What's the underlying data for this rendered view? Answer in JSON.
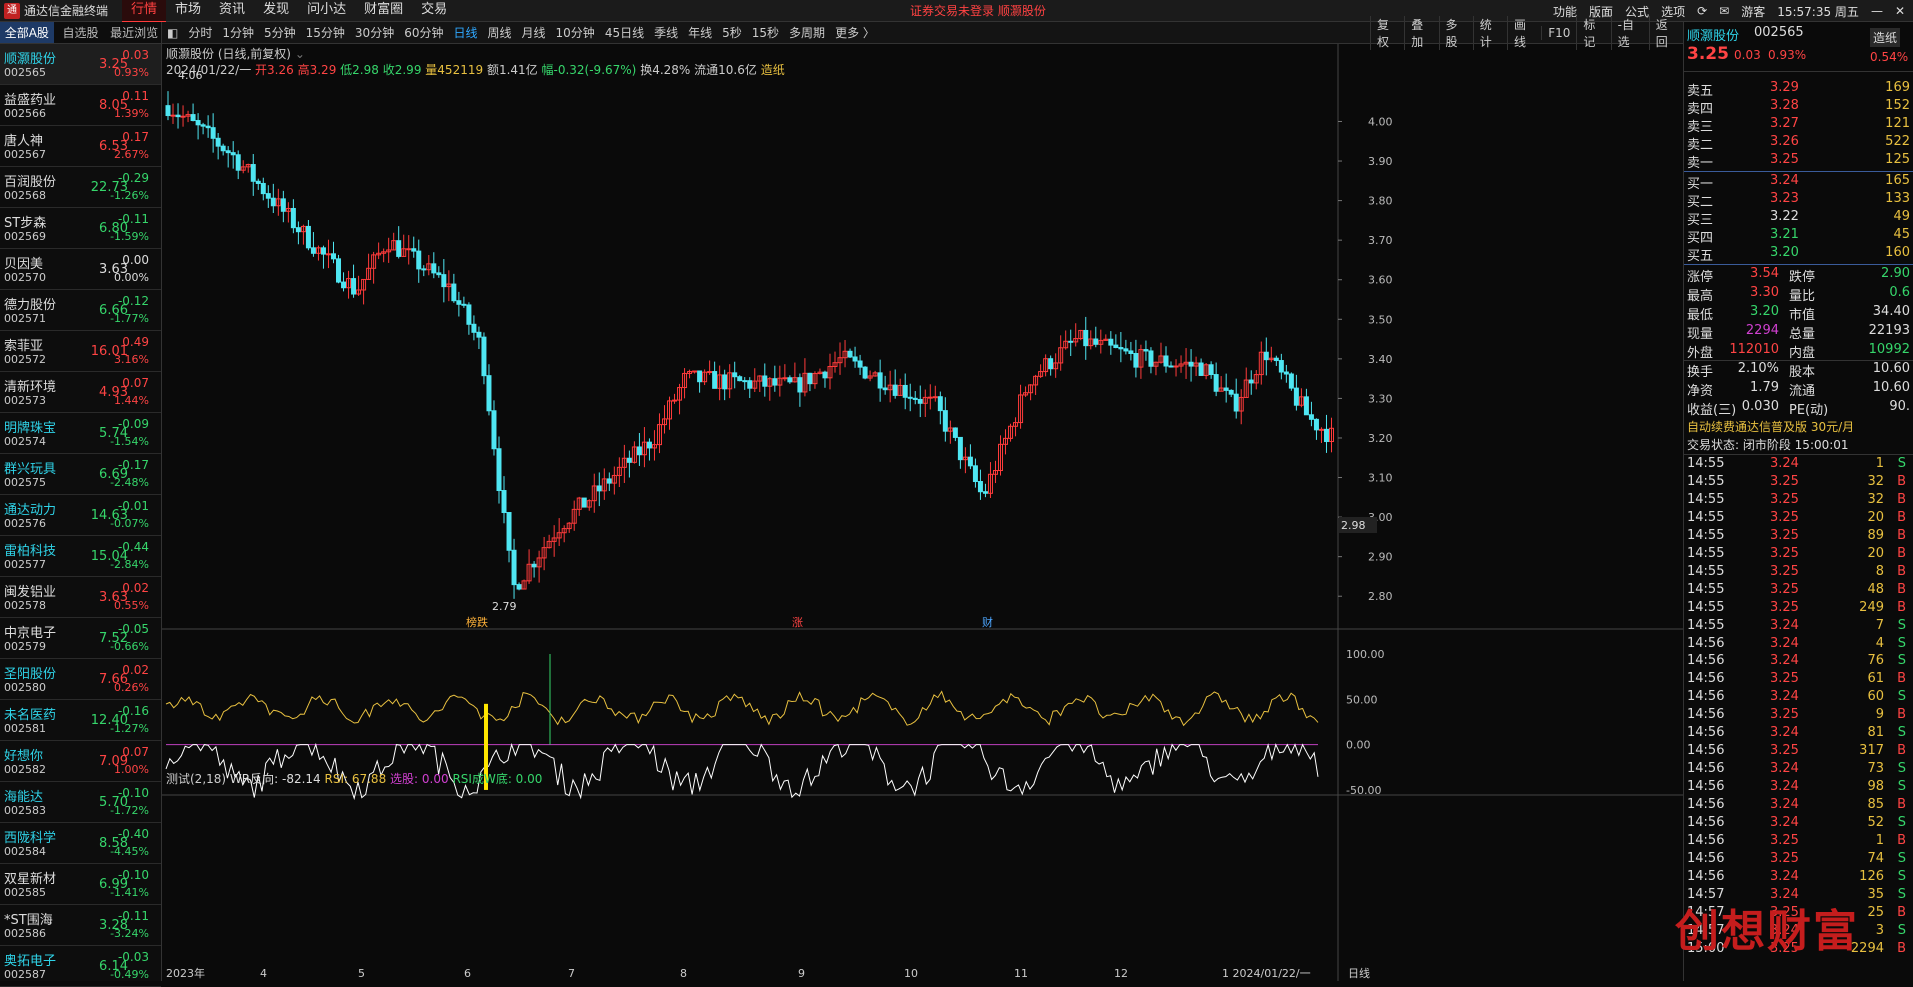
{
  "app": {
    "title": "通达信金融终端",
    "menu": [
      "行情",
      "市场",
      "资讯",
      "发现",
      "问小达",
      "财富圈",
      "交易"
    ],
    "notice": "证券交易未登录  顺灏股份",
    "right_menu": [
      "功能",
      "版面",
      "公式",
      "选项"
    ],
    "user": "游客",
    "clock": "15:57:35 周五"
  },
  "left": {
    "tabs": [
      "全部A股",
      "自选股",
      "最近浏览"
    ],
    "stocks": [
      {
        "name": "顺灏股份",
        "code": "002565",
        "price": "3.25",
        "chg": "0.03",
        "pct": "0.93%",
        "dir": "up",
        "cyan": true
      },
      {
        "name": "益盛药业",
        "code": "002566",
        "price": "8.05",
        "chg": "0.11",
        "pct": "1.39%",
        "dir": "up",
        "cyan": false
      },
      {
        "name": "唐人神",
        "code": "002567",
        "price": "6.53",
        "chg": "0.17",
        "pct": "2.67%",
        "dir": "up",
        "cyan": false
      },
      {
        "name": "百润股份",
        "code": "002568",
        "price": "22.73",
        "chg": "-0.29",
        "pct": "-1.26%",
        "dir": "dn",
        "cyan": false
      },
      {
        "name": "ST步森",
        "code": "002569",
        "price": "6.80",
        "chg": "-0.11",
        "pct": "-1.59%",
        "dir": "dn",
        "cyan": false
      },
      {
        "name": "贝因美",
        "code": "002570",
        "price": "3.63",
        "chg": "0.00",
        "pct": "0.00%",
        "dir": "fl",
        "cyan": false
      },
      {
        "name": "德力股份",
        "code": "002571",
        "price": "6.66",
        "chg": "-0.12",
        "pct": "-1.77%",
        "dir": "dn",
        "cyan": false
      },
      {
        "name": "索菲亚",
        "code": "002572",
        "price": "16.01",
        "chg": "0.49",
        "pct": "3.16%",
        "dir": "up",
        "cyan": false
      },
      {
        "name": "清新环境",
        "code": "002573",
        "price": "4.93",
        "chg": "0.07",
        "pct": "1.44%",
        "dir": "up",
        "cyan": false
      },
      {
        "name": "明牌珠宝",
        "code": "002574",
        "price": "5.74",
        "chg": "-0.09",
        "pct": "-1.54%",
        "dir": "dn",
        "cyan": true
      },
      {
        "name": "群兴玩具",
        "code": "002575",
        "price": "6.69",
        "chg": "-0.17",
        "pct": "-2.48%",
        "dir": "dn",
        "cyan": true
      },
      {
        "name": "通达动力",
        "code": "002576",
        "price": "14.63",
        "chg": "-0.01",
        "pct": "-0.07%",
        "dir": "dn",
        "cyan": true
      },
      {
        "name": "雷柏科技",
        "code": "002577",
        "price": "15.04",
        "chg": "-0.44",
        "pct": "-2.84%",
        "dir": "dn",
        "cyan": true
      },
      {
        "name": "闽发铝业",
        "code": "002578",
        "price": "3.63",
        "chg": "0.02",
        "pct": "0.55%",
        "dir": "up",
        "cyan": false
      },
      {
        "name": "中京电子",
        "code": "002579",
        "price": "7.52",
        "chg": "-0.05",
        "pct": "-0.66%",
        "dir": "dn",
        "cyan": false
      },
      {
        "name": "圣阳股份",
        "code": "002580",
        "price": "7.66",
        "chg": "0.02",
        "pct": "0.26%",
        "dir": "up",
        "cyan": true
      },
      {
        "name": "未名医药",
        "code": "002581",
        "price": "12.40",
        "chg": "-0.16",
        "pct": "-1.27%",
        "dir": "dn",
        "cyan": true
      },
      {
        "name": "好想你",
        "code": "002582",
        "price": "7.09",
        "chg": "0.07",
        "pct": "1.00%",
        "dir": "up",
        "cyan": true
      },
      {
        "name": "海能达",
        "code": "002583",
        "price": "5.70",
        "chg": "-0.10",
        "pct": "-1.72%",
        "dir": "dn",
        "cyan": true
      },
      {
        "name": "西陇科学",
        "code": "002584",
        "price": "8.58",
        "chg": "-0.40",
        "pct": "-4.45%",
        "dir": "dn",
        "cyan": true
      },
      {
        "name": "双星新材",
        "code": "002585",
        "price": "6.99",
        "chg": "-0.10",
        "pct": "-1.41%",
        "dir": "dn",
        "cyan": false
      },
      {
        "name": "*ST围海",
        "code": "002586",
        "price": "3.28",
        "chg": "-0.11",
        "pct": "-3.24%",
        "dir": "dn",
        "cyan": false
      },
      {
        "name": "奥拓电子",
        "code": "002587",
        "price": "6.14",
        "chg": "-0.03",
        "pct": "-0.49%",
        "dir": "dn",
        "cyan": true
      }
    ]
  },
  "timeframes": [
    "分时",
    "1分钟",
    "5分钟",
    "15分钟",
    "30分钟",
    "60分钟",
    "日线",
    "周线",
    "月线",
    "10分钟",
    "45日线",
    "季线",
    "年线",
    "5秒",
    "15秒",
    "多周期",
    "更多 〉"
  ],
  "active_tf": "日线",
  "tf_right": [
    "复权",
    "叠加",
    "多股",
    "统计",
    "画线",
    "F10",
    "标记",
    "-自选",
    "返回"
  ],
  "stock_info": "顺灏股份 (日线,前复权)",
  "quote": {
    "date": "2024/01/22/一",
    "open": "开3.26",
    "high": "高3.29",
    "low": "低2.98",
    "close": "收2.99",
    "vol": "量452119",
    "amt": "额1.41亿",
    "rng": "幅-0.32(-9.67%)",
    "turn": "换4.28%",
    "float": "流通10.6亿",
    "tag": "造纸"
  },
  "indicator": {
    "name": "测试(2,18)",
    "wr": "WR反向: -82.14",
    "rsi": "RSI: 67.88",
    "sel": "选股: 0.00",
    "rsiw": "RSI成W底: 0.00"
  },
  "chart_labels": {
    "max": "4.06",
    "min": "2.79",
    "cur": "2.98",
    "markers": [
      "榜跌",
      "涨",
      "财"
    ]
  },
  "chart_data": {
    "type": "candlestick",
    "ylim": [
      2.75,
      4.12
    ],
    "yticks": [
      "4.00",
      "3.90",
      "3.80",
      "3.70",
      "3.60",
      "3.50",
      "3.40",
      "3.30",
      "3.20",
      "3.10",
      "3.00",
      "2.90",
      "2.80"
    ],
    "xticks": [
      "2023年",
      "4",
      "5",
      "6",
      "7",
      "8",
      "9",
      "10",
      "11",
      "12",
      "1 2024/01/22/一"
    ],
    "ind_yticks": [
      "100.00",
      "50.00",
      "0.00",
      "-50.00"
    ],
    "xbar": "日线"
  },
  "right": {
    "name": "顺灏股份",
    "code": "002565",
    "price": "3.25",
    "chg": "0.03",
    "pct": "0.93%",
    "tag": "造纸",
    "tagpct": "0.54%",
    "asks": [
      [
        "卖五",
        "3.29",
        "169"
      ],
      [
        "卖四",
        "3.28",
        "152"
      ],
      [
        "卖三",
        "3.27",
        "121"
      ],
      [
        "卖二",
        "3.26",
        "522"
      ],
      [
        "卖一",
        "3.25",
        "125"
      ]
    ],
    "bids": [
      [
        "买一",
        "3.24",
        "165"
      ],
      [
        "买二",
        "3.23",
        "133"
      ],
      [
        "买三",
        "3.22",
        "49"
      ],
      [
        "买四",
        "3.21",
        "45"
      ],
      [
        "买五",
        "3.20",
        "160"
      ]
    ],
    "stats": [
      [
        "涨停",
        "3.54",
        "跌停",
        "2.90"
      ],
      [
        "最高",
        "3.30",
        "量比",
        "0.6"
      ],
      [
        "最低",
        "3.20",
        "市值",
        "34.40"
      ],
      [
        "现量",
        "2294",
        "总量",
        "22193"
      ],
      [
        "外盘",
        "112010",
        "内盘",
        "10992"
      ],
      [
        "换手",
        "2.10%",
        "股本",
        "10.60"
      ],
      [
        "净资",
        "1.79",
        "流通",
        "10.60"
      ],
      [
        "收益(三)",
        "0.030",
        "PE(动)",
        "90."
      ]
    ],
    "promo": "自动续费通达信普及版   30元/月",
    "status": "交易状态: 闭市阶段 15:00:01",
    "ticks": [
      [
        "14:55",
        "3.24",
        "1",
        "S"
      ],
      [
        "14:55",
        "3.25",
        "32",
        "B"
      ],
      [
        "14:55",
        "3.25",
        "32",
        "B"
      ],
      [
        "14:55",
        "3.25",
        "20",
        "B"
      ],
      [
        "14:55",
        "3.25",
        "89",
        "B"
      ],
      [
        "14:55",
        "3.25",
        "20",
        "B"
      ],
      [
        "14:55",
        "3.25",
        "8",
        "B"
      ],
      [
        "14:55",
        "3.25",
        "48",
        "B"
      ],
      [
        "14:55",
        "3.25",
        "249",
        "B"
      ],
      [
        "14:55",
        "3.24",
        "7",
        "S"
      ],
      [
        "14:56",
        "3.24",
        "4",
        "S"
      ],
      [
        "14:56",
        "3.24",
        "76",
        "S"
      ],
      [
        "14:56",
        "3.25",
        "61",
        "B"
      ],
      [
        "14:56",
        "3.24",
        "60",
        "S"
      ],
      [
        "14:56",
        "3.25",
        "9",
        "B"
      ],
      [
        "14:56",
        "3.24",
        "81",
        "S"
      ],
      [
        "14:56",
        "3.25",
        "317",
        "B"
      ],
      [
        "14:56",
        "3.24",
        "73",
        "S"
      ],
      [
        "14:56",
        "3.24",
        "98",
        "S"
      ],
      [
        "14:56",
        "3.24",
        "85",
        "B"
      ],
      [
        "14:56",
        "3.24",
        "52",
        "S"
      ],
      [
        "14:56",
        "3.25",
        "1",
        "B"
      ],
      [
        "14:56",
        "3.25",
        "74",
        "S"
      ],
      [
        "14:56",
        "3.24",
        "126",
        "S"
      ],
      [
        "14:57",
        "3.24",
        "35",
        "S"
      ],
      [
        "14:57",
        "3.25",
        "25",
        "B"
      ],
      [
        "14:57",
        "3.24",
        "3",
        "S"
      ],
      [
        "15:00",
        "3.25",
        "2294",
        "B"
      ]
    ]
  },
  "watermark": "创想财富"
}
